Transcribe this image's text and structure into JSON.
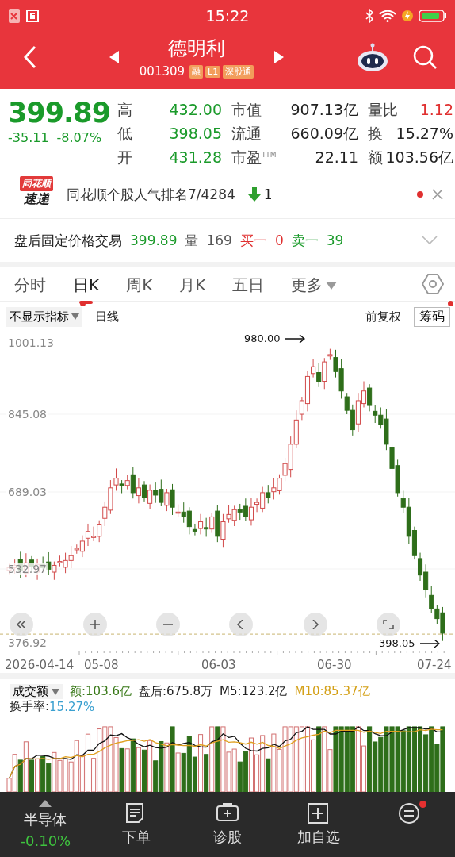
{
  "status_bar": {
    "time": "15:22"
  },
  "header": {
    "title": "德明利",
    "code": "001309",
    "tags": [
      "融",
      "L1",
      "深股通"
    ]
  },
  "quote": {
    "price": "399.89",
    "change": "-35.11",
    "change_pct": "-8.07%",
    "color": "#1a9a2a",
    "stats": [
      {
        "label": "高",
        "value": "432.00",
        "color": "#1a9a2a"
      },
      {
        "label": "市值",
        "value": "907.13亿",
        "color": "#222222"
      },
      {
        "label": "量比",
        "value": "1.12",
        "color": "#e03030"
      },
      {
        "label": "低",
        "value": "398.05",
        "color": "#1a9a2a"
      },
      {
        "label": "流通",
        "value": "660.09亿",
        "color": "#222222"
      },
      {
        "label": "换",
        "value": "15.27%",
        "color": "#222222"
      },
      {
        "label": "开",
        "value": "431.28",
        "color": "#1a9a2a"
      },
      {
        "label": "市盈$^{TTM}$",
        "value": "22.11",
        "color": "#222222"
      },
      {
        "label": "额",
        "value": "103.56亿",
        "color": "#222222"
      }
    ]
  },
  "news": {
    "logo_top": "同花顺",
    "logo_bottom": "速递",
    "text": "同花顺个股人气排名7/4284",
    "rank_change": "1",
    "unread": true
  },
  "after_hours": {
    "label": "盘后固定价格交易",
    "price": "399.89",
    "volume_label": "量",
    "volume": "169",
    "bid_label": "买一",
    "bid": "0",
    "ask_label": "卖一",
    "ask": "39"
  },
  "tabs": [
    {
      "label": "分时",
      "selected": false
    },
    {
      "label": "日K",
      "selected": true
    },
    {
      "label": "周K",
      "selected": false
    },
    {
      "label": "月K",
      "selected": false
    },
    {
      "label": "五日",
      "selected": false
    },
    {
      "label": "更多",
      "selected": false,
      "dropdown": true
    }
  ],
  "chart_toolbar": {
    "indicator": "不显示指标",
    "indicator_badge": true,
    "period": "日线",
    "adjust": "前复权",
    "chips_button": "筹码",
    "chips_badge": true
  },
  "price_chart": {
    "y_labels": [
      "1001.13",
      "845.08",
      "689.03",
      "532.97",
      "376.92"
    ],
    "high_marker": "980.00",
    "low_marker": "398.05",
    "dates": [
      "2026-04-14",
      "05-08",
      "06-03",
      "06-30",
      "07-24"
    ]
  },
  "volume": {
    "indicator": "成交额",
    "amount": "额:103.6亿",
    "after_hours": "盘后:675.8万",
    "m5": "M5:123.2亿",
    "m10": "M10:85.37亿",
    "turnover_label": "换手率:",
    "turnover": "15.27%"
  },
  "bottom_nav": {
    "sector": {
      "name": "半导体",
      "change": "-0.10%",
      "color": "#3fc43f"
    },
    "items": [
      {
        "kind": "order",
        "label": "下单"
      },
      {
        "kind": "diagnose",
        "label": "诊股"
      },
      {
        "kind": "add",
        "label": "加自选"
      },
      {
        "kind": "menu",
        "badge": true
      }
    ]
  }
}
